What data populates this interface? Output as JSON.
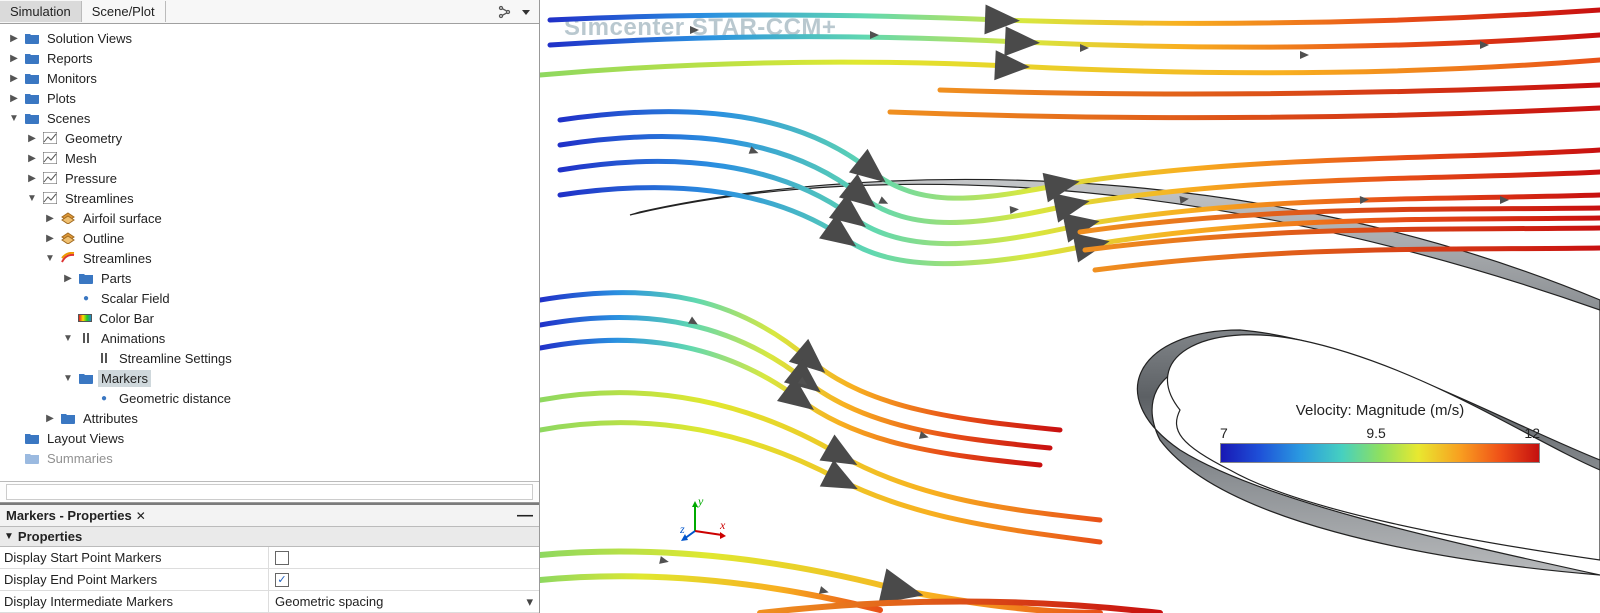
{
  "tabs": {
    "simulation": "Simulation",
    "sceneplot": "Scene/Plot"
  },
  "tree": {
    "solution_views": "Solution Views",
    "reports": "Reports",
    "monitors": "Monitors",
    "plots": "Plots",
    "scenes": "Scenes",
    "geometry": "Geometry",
    "mesh": "Mesh",
    "pressure": "Pressure",
    "streamlines": "Streamlines",
    "airfoil_surface": "Airfoil surface",
    "outline": "Outline",
    "streamlines_inner": "Streamlines",
    "parts": "Parts",
    "scalar_field": "Scalar Field",
    "color_bar": "Color Bar",
    "animations": "Animations",
    "streamline_settings": "Streamline Settings",
    "markers": "Markers",
    "geometric_distance": "Geometric distance",
    "attributes": "Attributes",
    "layout_views": "Layout Views",
    "summaries": "Summaries"
  },
  "props": {
    "panel_title": "Markers - Properties",
    "section": "Properties",
    "rows": {
      "display_start": "Display Start Point Markers",
      "display_end": "Display End Point Markers",
      "display_intermediate": "Display Intermediate Markers",
      "intermediate_value": "Geometric spacing"
    },
    "start_checked": false,
    "end_checked": true
  },
  "view": {
    "watermark": "Simcenter STAR-CCM+",
    "axes": {
      "x": "x",
      "y": "y",
      "z": "z"
    }
  },
  "legend": {
    "title": "Velocity: Magnitude (m/s)",
    "min": "7",
    "mid": "9.5",
    "max": "12"
  }
}
